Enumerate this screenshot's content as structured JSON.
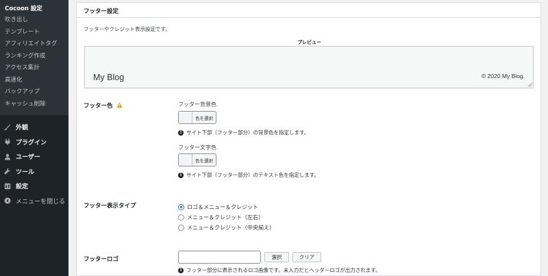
{
  "sidebar": {
    "submenu_title": "Cocoon 設定",
    "submenu_items": [
      "吹き出し",
      "テンプレート",
      "アフィリエイトタグ",
      "ランキング作成",
      "アクセス集計",
      "高速化",
      "バックアップ",
      "キャッシュ削除"
    ],
    "menu": {
      "appearance": {
        "label": "外観",
        "icon": "paintbrush-icon"
      },
      "plugins": {
        "label": "プラグイン",
        "icon": "plugin-icon"
      },
      "users": {
        "label": "ユーザー",
        "icon": "user-icon"
      },
      "tools": {
        "label": "ツール",
        "icon": "wrench-icon"
      },
      "settings": {
        "label": "設定",
        "icon": "settings-icon"
      },
      "collapse": {
        "label": "メニューを閉じる",
        "icon": "collapse-icon"
      }
    }
  },
  "panel": {
    "title": "フッター設定",
    "description": "フッターやクレジット表示設定です。",
    "preview_label": "プレビュー",
    "preview_blog_name": "My Blog",
    "preview_copyright": "© 2020 My Blog."
  },
  "footer_color": {
    "label": "フッター色",
    "bg_label": "フッター背景色",
    "bg_button": "色を選択",
    "bg_help": "サイト下部（フッター部分）の背景色を指定します。",
    "text_label": "フッター文字色",
    "text_button": "色を選択",
    "text_help": "サイト下部（フッター部分）のテキスト色を指定します。"
  },
  "footer_type": {
    "label": "フッター表示タイプ",
    "options": [
      {
        "label": "ロゴ＆メニュー＆クレジット",
        "checked": true
      },
      {
        "label": "メニュー＆クレジット（左右）",
        "checked": false
      },
      {
        "label": "メニュー＆クレジット（中央揃え）",
        "checked": false
      }
    ]
  },
  "footer_logo": {
    "label": "フッターロゴ",
    "input_value": "",
    "select_button": "選択",
    "clear_button": "クリア",
    "help": "フッター部分に表示されるロゴ画像です。未入力だとヘッダーロゴが出力されます。"
  },
  "colors": {
    "sidebar_bg": "#1d2327",
    "submenu_bg": "#2c3338",
    "accent": "#2271b1",
    "warning": "#dba617"
  }
}
